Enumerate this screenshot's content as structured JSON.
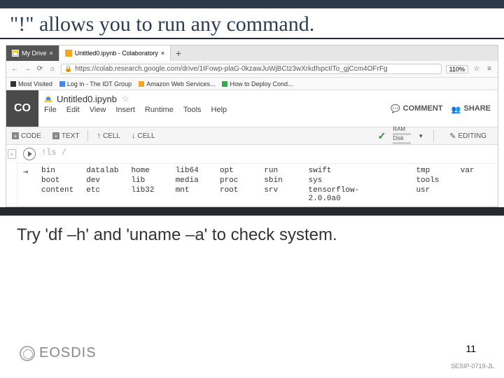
{
  "slide": {
    "title_q1": "\"!\"",
    "title_rest": " allows you to run any command.",
    "instruction": "Try 'df –h' and 'uname –a' to check system.",
    "page": "11",
    "code": "SESIP-0719-JL",
    "logo": "EOSDIS"
  },
  "browser": {
    "tabs": [
      {
        "label": "My Drive"
      },
      {
        "label": "Untitled0.ipynb - Colaboratory"
      }
    ],
    "url": "https://colab.research.google.com/drive/1IFowp-plaG-0kzawJuWjBCtz3wXrkdfspcIITo_gjCcm4OFrFg",
    "zoom": "110%",
    "bookmarks": [
      "Most Visited",
      "Log in - The IDT Group",
      "Amazon Web Services...",
      "How to Deploy Cond..."
    ]
  },
  "colab": {
    "logo": "CO",
    "filename": "Untitled0.ipynb",
    "menu": [
      "File",
      "Edit",
      "View",
      "Insert",
      "Runtime",
      "Tools",
      "Help"
    ],
    "actions": {
      "comment": "COMMENT",
      "share": "SHARE"
    },
    "toolbar": {
      "code": "CODE",
      "text": "TEXT",
      "cell1": "CELL",
      "cell2": "CELL",
      "ram": "RAM",
      "disk": "Disk",
      "editing": "EDITING"
    }
  },
  "cells": {
    "cmd": "!ls /",
    "output": [
      "bin",
      "datalab",
      "home",
      "lib64",
      "opt",
      "run",
      "swift",
      "",
      "tmp",
      "var",
      "boot",
      "dev",
      "lib",
      "media",
      "proc",
      "sbin",
      "sys",
      "",
      "tools",
      "",
      "content",
      "etc",
      "lib32",
      "mnt",
      "root",
      "srv",
      "tensorflow-2.0.0a0",
      "",
      "usr",
      ""
    ]
  }
}
